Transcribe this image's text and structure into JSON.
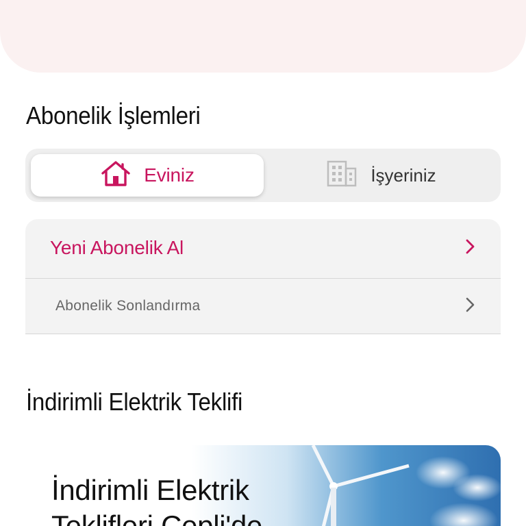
{
  "subscriptions": {
    "title": "Abonelik İşlemleri",
    "segments": [
      {
        "label": "Eviniz",
        "icon": "house-icon",
        "active": true
      },
      {
        "label": "İşyeriniz",
        "icon": "building-icon",
        "active": false
      }
    ],
    "actions": [
      {
        "label": "Yeni Abonelik Al",
        "icon": "chevron-right-icon"
      },
      {
        "label": "Abonelik Sonlandırma",
        "icon": "chevron-right-icon"
      }
    ]
  },
  "offer": {
    "title": "İndirimli Elektrik Teklifi",
    "banner_text": "İndirimli Elektrik Teklifleri Cepli'de"
  },
  "colors": {
    "accent": "#c8155e",
    "banner_bg": "#fbf1f1",
    "card_bg": "#f3f3f3",
    "segment_bg": "#efefef"
  }
}
